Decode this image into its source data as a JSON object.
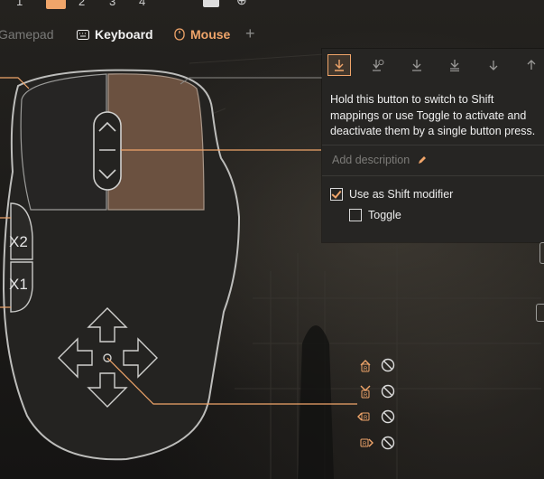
{
  "top_slots": [
    {
      "label": "1",
      "active": false
    },
    {
      "label": "",
      "active": true
    },
    {
      "label": "2",
      "active": false
    },
    {
      "label": "3",
      "active": false
    },
    {
      "label": "4",
      "active": false
    }
  ],
  "device_tabs": {
    "gamepad": "Gamepad",
    "keyboard": "Keyboard",
    "mouse": "Mouse",
    "add": "+"
  },
  "mouse": {
    "side_buttons": [
      "X2",
      "X1"
    ]
  },
  "shift_panel": {
    "tools": [
      "shift-hold-icon",
      "shift-toggle-icon",
      "shift-down-icon",
      "shift-double-icon",
      "arrow-down-icon",
      "arrow-up-icon"
    ],
    "description": "Hold this button to switch to Shift mappings or use Toggle to activate and deactivate them by a single button press.",
    "add_description": "Add description",
    "use_shift_label": "Use as Shift modifier",
    "use_shift_checked": true,
    "toggle_label": "Toggle",
    "toggle_checked": false
  },
  "scroll_actions": [
    {
      "icon": "scroll-up-icon",
      "action": "none"
    },
    {
      "icon": "scroll-down-icon",
      "action": "none"
    },
    {
      "icon": "scroll-left-icon",
      "action": "none"
    },
    {
      "icon": "scroll-right-icon",
      "action": "none"
    }
  ],
  "colors": {
    "accent": "#f0a56a",
    "panel": "#262523",
    "line": "#c9c9c7"
  }
}
